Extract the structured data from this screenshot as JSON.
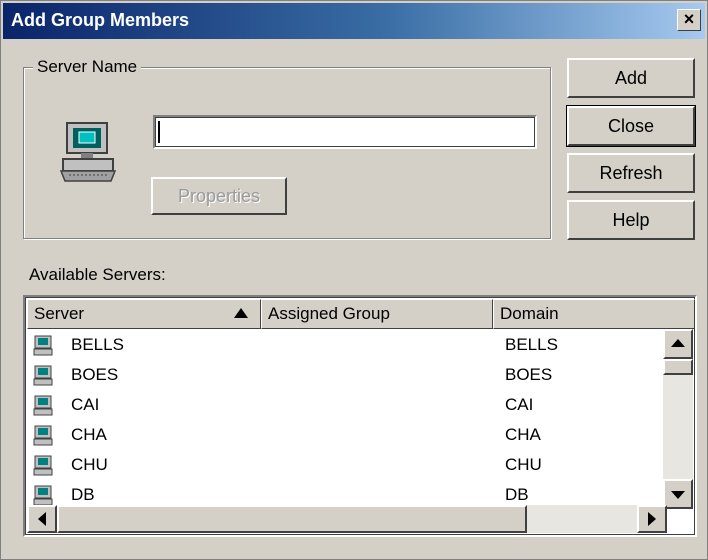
{
  "window": {
    "title": "Add Group Members",
    "close_label": "×"
  },
  "server_group": {
    "label": "Server Name",
    "input_value": "",
    "properties_label": "Properties"
  },
  "buttons": {
    "add": "Add",
    "close": "Close",
    "refresh": "Refresh",
    "help": "Help"
  },
  "available": {
    "label": "Available Servers:",
    "columns": [
      "Server",
      "Assigned Group",
      "Domain"
    ],
    "rows": [
      {
        "server": "BELLS",
        "group": "",
        "domain": "BELLS"
      },
      {
        "server": "BOES",
        "group": "",
        "domain": "BOES"
      },
      {
        "server": "CAI",
        "group": "",
        "domain": "CAI"
      },
      {
        "server": "CHA",
        "group": "",
        "domain": "CHA"
      },
      {
        "server": "CHU",
        "group": "",
        "domain": "CHU"
      },
      {
        "server": "DB",
        "group": "",
        "domain": "DB"
      }
    ]
  },
  "icons": {
    "server": "computer-icon",
    "sort": "sort-ascending-icon"
  },
  "colors": {
    "title_start": "#0a246a",
    "title_end": "#a6caf0",
    "face": "#d4d0c8"
  }
}
